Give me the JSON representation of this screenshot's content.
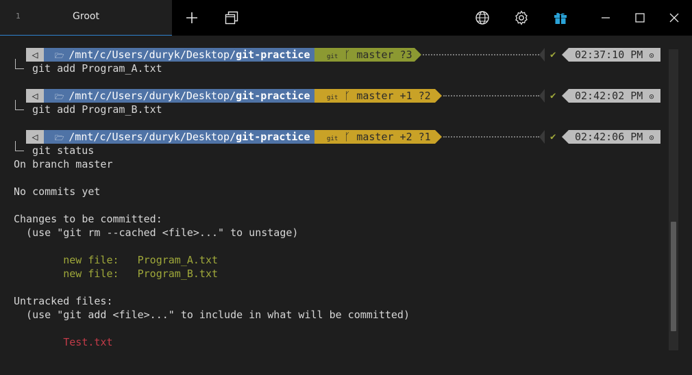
{
  "tab": {
    "number": "1",
    "title": "Groot"
  },
  "icons": [
    "plus-icon",
    "duplicate-tab-icon",
    "globe-icon",
    "gear-icon",
    "gift-icon",
    "minimize-icon",
    "maximize-icon",
    "close-icon"
  ],
  "prompts": [
    {
      "path": "/mnt/c/Users/duryk/Desktop/",
      "repo": "git-practice",
      "git": "git",
      "branch": "master ?3",
      "time": "02:37:10 PM",
      "command": "git add Program_A.txt",
      "color": "#8c9932"
    },
    {
      "path": "/mnt/c/Users/duryk/Desktop/",
      "repo": "git-practice",
      "git": "git",
      "branch": "master +1 ?2",
      "time": "02:42:02 PM",
      "command": "git add Program_B.txt",
      "color": "#c9a227"
    },
    {
      "path": "/mnt/c/Users/duryk/Desktop/",
      "repo": "git-practice",
      "git": "git",
      "branch": "master +2 ?1",
      "time": "02:42:06 PM",
      "command": "git status",
      "color": "#c9a227"
    }
  ],
  "output": {
    "branch": "On branch master",
    "no_commits": "No commits yet",
    "changes_header": "Changes to be committed:",
    "changes_hint": "  (use \"git rm --cached <file>...\" to unstage)",
    "new_file_a": "        new file:   Program_A.txt",
    "new_file_b": "        new file:   Program_B.txt",
    "untracked_header": "Untracked files:",
    "untracked_hint": "  (use \"git add <file>...\" to include in what will be committed)",
    "untracked_file": "        Test.txt"
  }
}
